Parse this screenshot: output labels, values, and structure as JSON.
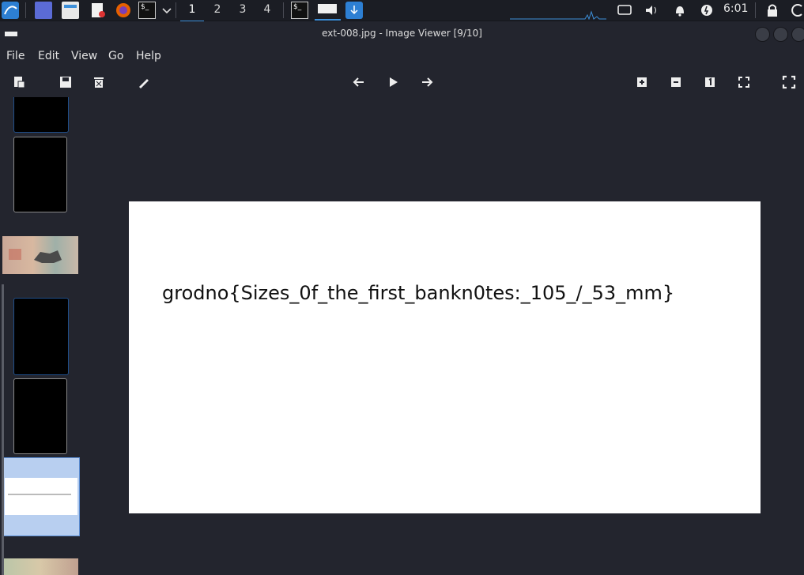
{
  "panel": {
    "workspaces": [
      "1",
      "2",
      "3",
      "4"
    ],
    "clock": "6:01",
    "icons": [
      "kali-menu-icon",
      "workspace-switcher-icon",
      "file-manager-icon",
      "text-editor-icon",
      "firefox-icon",
      "terminal-icon",
      "chevron-down-icon",
      "terminal-icon",
      "image-viewer-task-icon",
      "download-icon",
      "network-icon",
      "volume-icon",
      "bell-icon",
      "power-icon",
      "lock-icon",
      "logout-icon"
    ]
  },
  "window": {
    "title": "ext-008.jpg - Image Viewer [9/10]"
  },
  "menu": {
    "items": [
      "File",
      "Edit",
      "View",
      "Go",
      "Help"
    ]
  },
  "toolbar": {
    "icons": [
      "open-icon",
      "save-icon",
      "delete-icon",
      "edit-icon",
      "back-arrow-icon",
      "play-icon",
      "forward-arrow-icon",
      "zoom-in-icon",
      "zoom-out-icon",
      "actual-size-icon",
      "fit-icon",
      "fullscreen-icon"
    ]
  },
  "viewer": {
    "image_text": "grodno{Sizes_0f_the_first_bankn0tes:_105_/_53_mm}"
  },
  "colors": {
    "background": "#23252e",
    "panel": "#1b1d24",
    "accent": "#3d8fd9",
    "selection": "#b8cff0"
  }
}
